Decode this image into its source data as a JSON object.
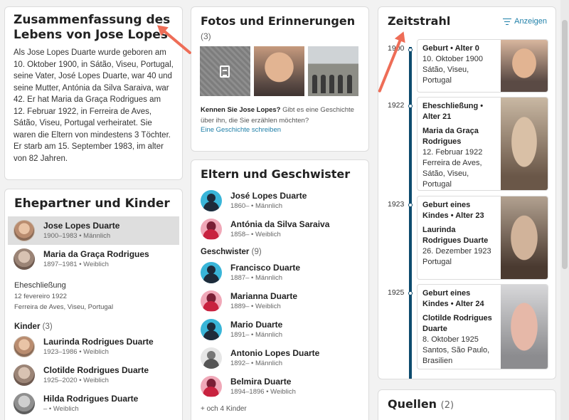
{
  "summary": {
    "title": "Zusammenfassung des Lebens von Jose Lopes",
    "text": "Als Jose Lopes Duarte wurde geboren am 10. Oktober 1900, in Sátão, Viseu, Portugal, seine Vater, José Lopes Duarte, war 40 und seine Mutter, Antónia da Silva Saraiva, war 42. Er hat Maria da Graça Rodrigues am 12. Februar 1922, in Ferreira de Aves, Sátão, Viseu, Portugal verheiratet. Sie waren die Eltern von mindestens 3 Töchter. Er starb am 15. September 1983, im alter von 82 Jahren."
  },
  "family": {
    "title": "Ehepartner und Kinder",
    "self": {
      "name": "Jose Lopes Duarte",
      "meta": "1900–1983 • Männlich"
    },
    "spouse": {
      "name": "Maria da Graça Rodrigues",
      "meta": "1897–1981 • Weiblich"
    },
    "marriage": {
      "label": "Eheschließung",
      "date": "12 fevereiro 1922",
      "place": "Ferreira de Aves, Viseu, Portugal"
    },
    "children_label": "Kinder",
    "children_count": "(3)",
    "children": [
      {
        "name": "Laurinda Rodrigues Duarte",
        "meta": "1923–1986 • Weiblich"
      },
      {
        "name": "Clotilde Rodrigues Duarte",
        "meta": "1925–2020 • Weiblich"
      },
      {
        "name": "Hilda Rodrigues Duarte",
        "meta": "– • Weiblich"
      }
    ]
  },
  "photos": {
    "title": "Fotos und Erinnerungen",
    "count": "(3)",
    "prompt_bold": "Kennen Sie Jose Lopes?",
    "prompt_text": " Gibt es eine Geschichte über ihn, die Sie erzählen möchten?",
    "link": "Eine Geschichte schreiben"
  },
  "parents": {
    "title": "Eltern und Geschwister",
    "father": {
      "name": "José Lopes Duarte",
      "meta": "1860– • Männlich"
    },
    "mother": {
      "name": "Antónia da Silva Saraiva",
      "meta": "1858– • Weiblich"
    },
    "siblings_label": "Geschwister",
    "siblings_count": "(9)",
    "siblings": [
      {
        "name": "Francisco Duarte",
        "meta": "1887– • Männlich"
      },
      {
        "name": "Marianna Duarte",
        "meta": "1889– • Weiblich"
      },
      {
        "name": "Mario Duarte",
        "meta": "1891– • Männlich"
      },
      {
        "name": "Antonio Lopes Duarte",
        "meta": "1892– • Männlich"
      },
      {
        "name": "Belmira Duarte",
        "meta": "1894–1896 • Weiblich"
      }
    ],
    "more": "+ och 4 Kinder"
  },
  "timeline": {
    "title": "Zeitstrahl",
    "filter": "Anzeigen",
    "events": [
      {
        "year": "1900",
        "event": "Geburt • Alter 0",
        "person": "",
        "details": "10. Oktober 1900 Sátão, Viseu, Portugal"
      },
      {
        "year": "1922",
        "event": "Eheschließung • Alter 21",
        "person": "Maria da Graça Rodrigues",
        "details": "12. Februar 1922 Ferreira de Aves, Sátão, Viseu, Portugal"
      },
      {
        "year": "1923",
        "event": "Geburt eines Kindes • Alter 23",
        "person": "Laurinda Rodrigues Duarte",
        "details": "26. Dezember 1923 Portugal"
      },
      {
        "year": "1925",
        "event": "Geburt eines Kindes • Alter 24",
        "person": "Clotilde Rodrigues Duarte",
        "details": "8. Oktober 1925 Santos, São Paulo, Brasilien"
      }
    ]
  },
  "sources": {
    "title": "Quellen",
    "count": "(2)"
  },
  "colors": {
    "accent": "#1e7fa8",
    "timeline_line": "#0d4b6e",
    "annotation_arrow": "#ee6d57",
    "selected_row": "#dedede"
  }
}
